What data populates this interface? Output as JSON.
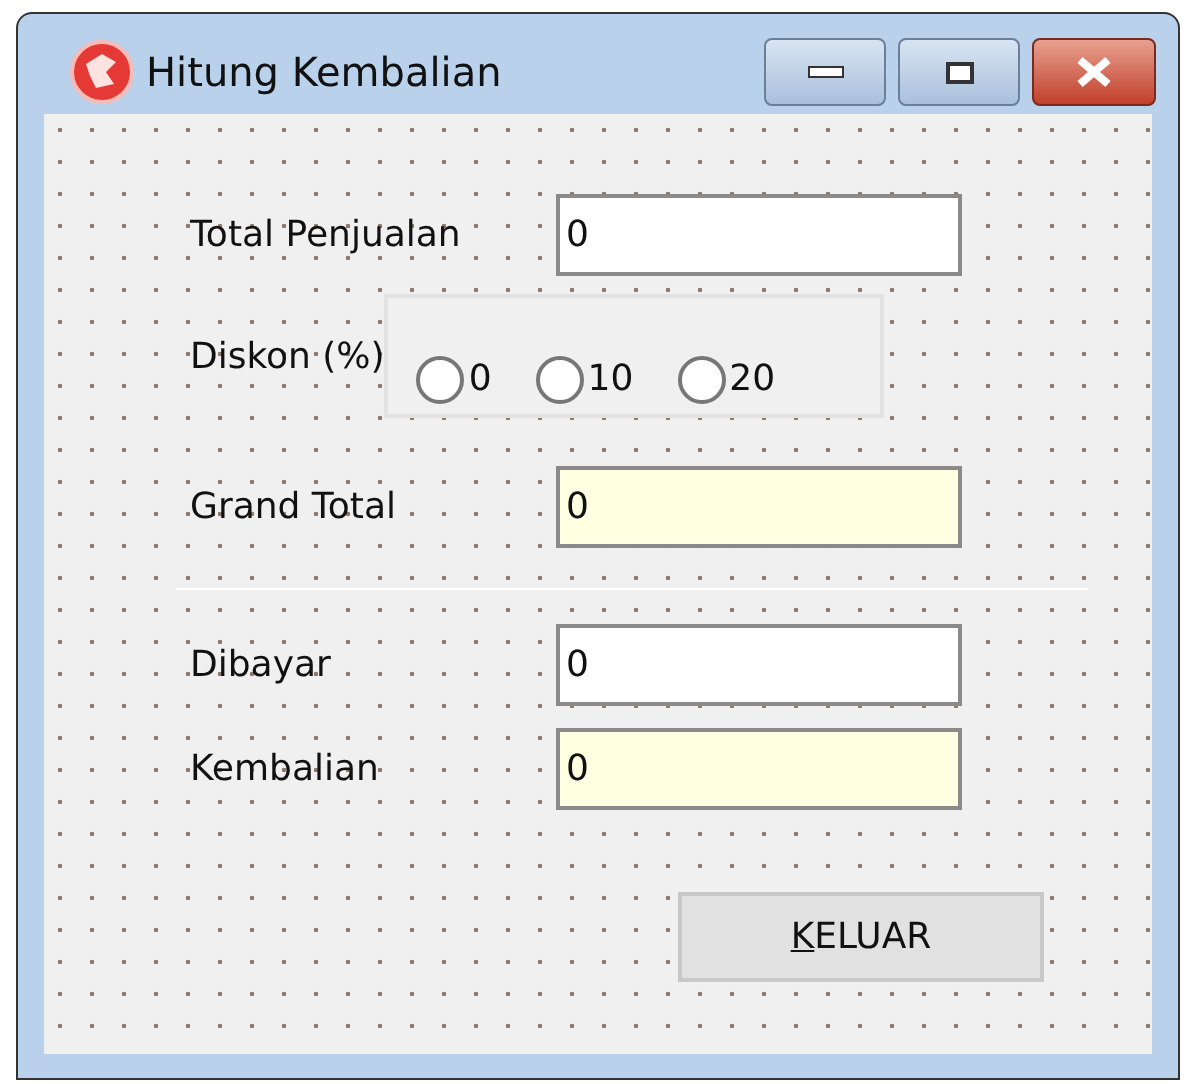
{
  "window": {
    "title": "Hitung Kembalian"
  },
  "fields": [
    {
      "label": "Total Penjualan",
      "value": "0",
      "readonly": false
    },
    {
      "label": "Diskon (%)",
      "kind": "radio",
      "options": [
        {
          "label": "0",
          "selected": false
        },
        {
          "label": "10",
          "selected": false
        },
        {
          "label": "20",
          "selected": false
        }
      ]
    },
    {
      "label": "Grand Total",
      "value": "0",
      "readonly": true
    },
    {
      "kind": "separator"
    },
    {
      "label": "Dibayar",
      "value": "0",
      "readonly": false
    },
    {
      "label": "Kembalian",
      "value": "0",
      "readonly": true
    }
  ],
  "button": {
    "label": "KELUAR",
    "underline_first": true
  }
}
